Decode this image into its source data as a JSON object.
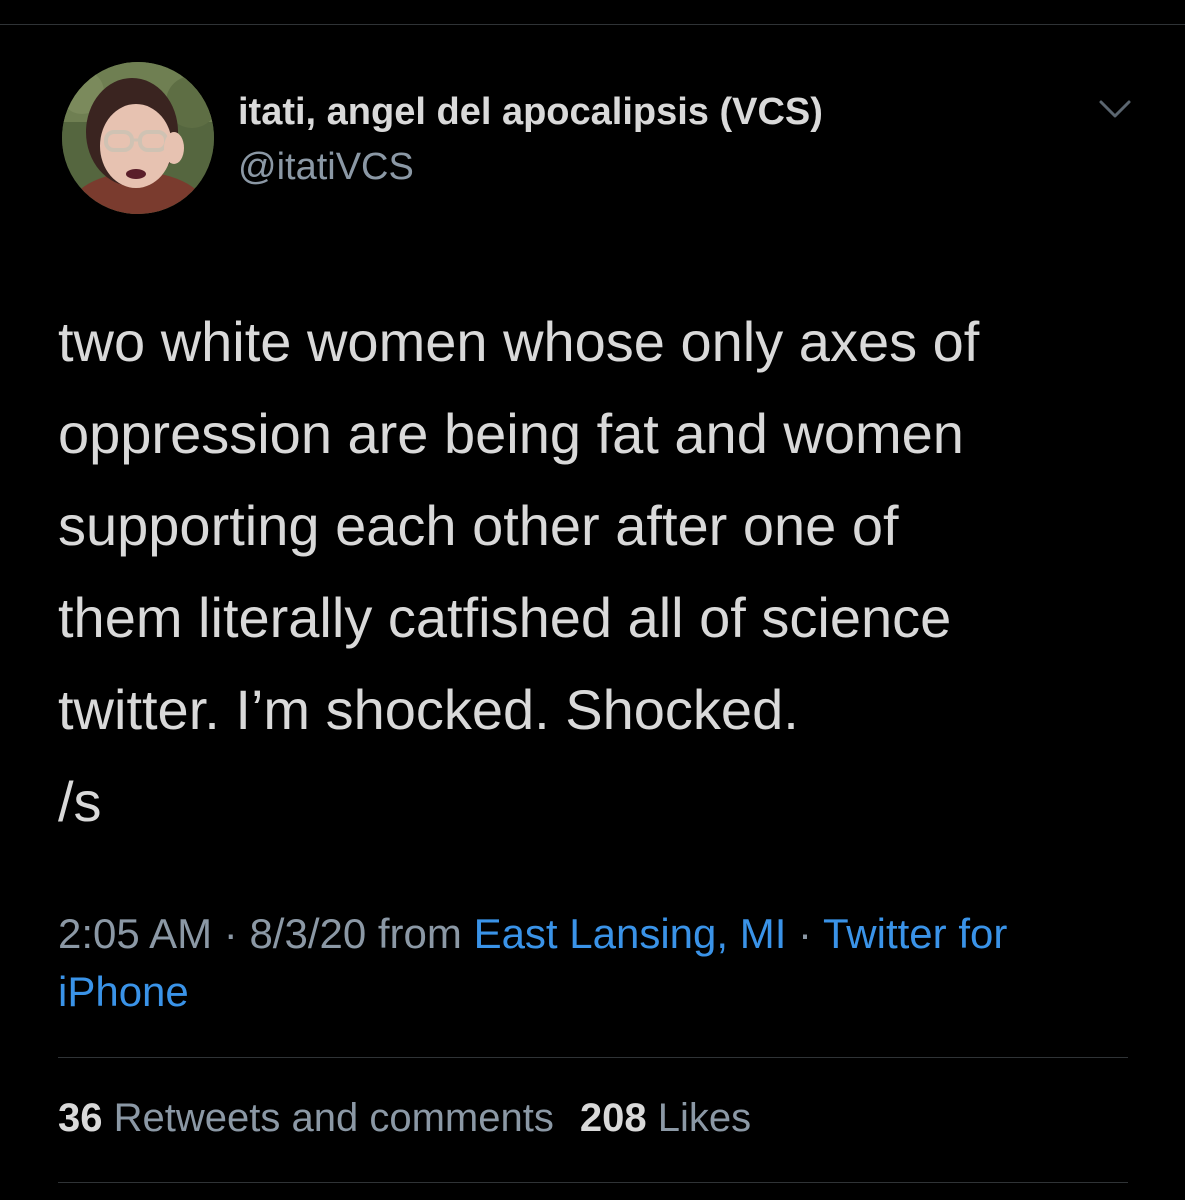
{
  "author": {
    "display_name": "itati, angel del apocalipsis (VCS)",
    "handle": "@itatiVCS"
  },
  "tweet": {
    "text": "two white women whose only axes of\noppression are being fat and women\nsupporting each other after one of\nthem literally catfished all of science\ntwitter. I’m shocked. Shocked.\n/s"
  },
  "meta": {
    "time": "2:05 AM",
    "separator": " · ",
    "date": "8/3/20",
    "from_label": " from ",
    "location": "East Lansing, MI",
    "source": "Twitter for iPhone"
  },
  "stats": {
    "retweets_count": "36",
    "retweets_label": "Retweets and comments",
    "likes_count": "208",
    "likes_label": "Likes"
  },
  "colors": {
    "background": "#000000",
    "text_primary": "#d9d9d9",
    "text_secondary": "#8b98a5",
    "link": "#3a93e8",
    "divider": "#2f3336"
  },
  "icons": {
    "more_menu": "chevron-down-icon",
    "avatar": "avatar"
  }
}
